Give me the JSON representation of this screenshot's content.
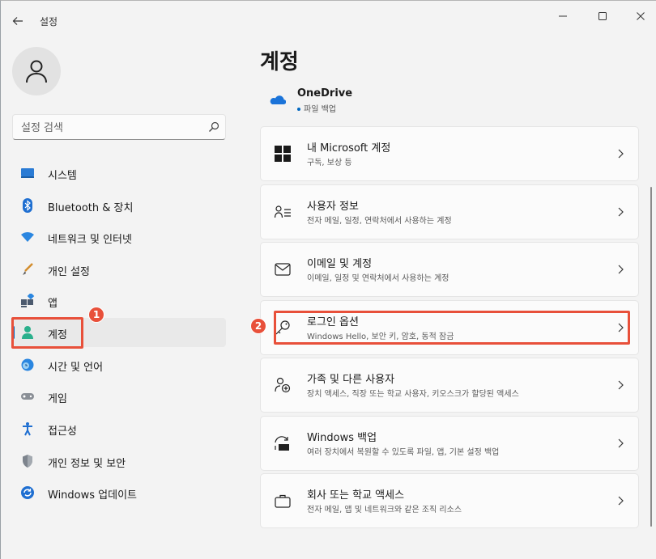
{
  "window": {
    "title": "설정"
  },
  "sidebar": {
    "search_placeholder": "설정 검색",
    "items": [
      {
        "label": "시스템",
        "icon": "monitor-icon"
      },
      {
        "label": "Bluetooth & 장치",
        "icon": "bluetooth-icon"
      },
      {
        "label": "네트워크 및 인터넷",
        "icon": "wifi-icon"
      },
      {
        "label": "개인 설정",
        "icon": "brush-icon"
      },
      {
        "label": "앱",
        "icon": "apps-icon"
      },
      {
        "label": "계정",
        "icon": "person-icon",
        "active": true
      },
      {
        "label": "시간 및 언어",
        "icon": "globe-clock-icon"
      },
      {
        "label": "게임",
        "icon": "gamepad-icon"
      },
      {
        "label": "접근성",
        "icon": "accessibility-icon"
      },
      {
        "label": "개인 정보 및 보안",
        "icon": "shield-icon"
      },
      {
        "label": "Windows 업데이트",
        "icon": "sync-icon"
      }
    ]
  },
  "annotations": {
    "badge1": "1",
    "badge2": "2",
    "color": "#e8503a"
  },
  "main": {
    "title": "계정",
    "onedrive": {
      "name": "OneDrive",
      "status": "파일 백업"
    },
    "cards": [
      {
        "title": "내 Microsoft 계정",
        "subtitle": "구독, 보상 등",
        "icon": "microsoft-logo-icon"
      },
      {
        "title": "사용자 정보",
        "subtitle": "전자 메일, 일정, 연락처에서 사용하는 계정",
        "icon": "user-info-icon"
      },
      {
        "title": "이메일 및 계정",
        "subtitle": "이메일, 일정 및 연락처에서 사용하는 계정",
        "icon": "mail-icon"
      },
      {
        "title": "로그인 옵션",
        "subtitle": "Windows Hello, 보안 키, 암호, 동적 잠금",
        "icon": "key-icon"
      },
      {
        "title": "가족 및 다른 사용자",
        "subtitle": "장치 액세스, 직장 또는 학교 사용자, 키오스크가 할당된 액세스",
        "icon": "family-icon"
      },
      {
        "title": "Windows 백업",
        "subtitle": "여러 장치에서 복원할 수 있도록 파일, 앱, 기본 설정 백업",
        "icon": "backup-icon"
      },
      {
        "title": "회사 또는 학교 액세스",
        "subtitle": "전자 메일, 앱 및 네트워크와 같은 조직 리소스",
        "icon": "briefcase-icon"
      }
    ]
  },
  "colors": {
    "accent": "#0067c0",
    "background": "#f3f3f3",
    "card": "#fbfbfb"
  }
}
